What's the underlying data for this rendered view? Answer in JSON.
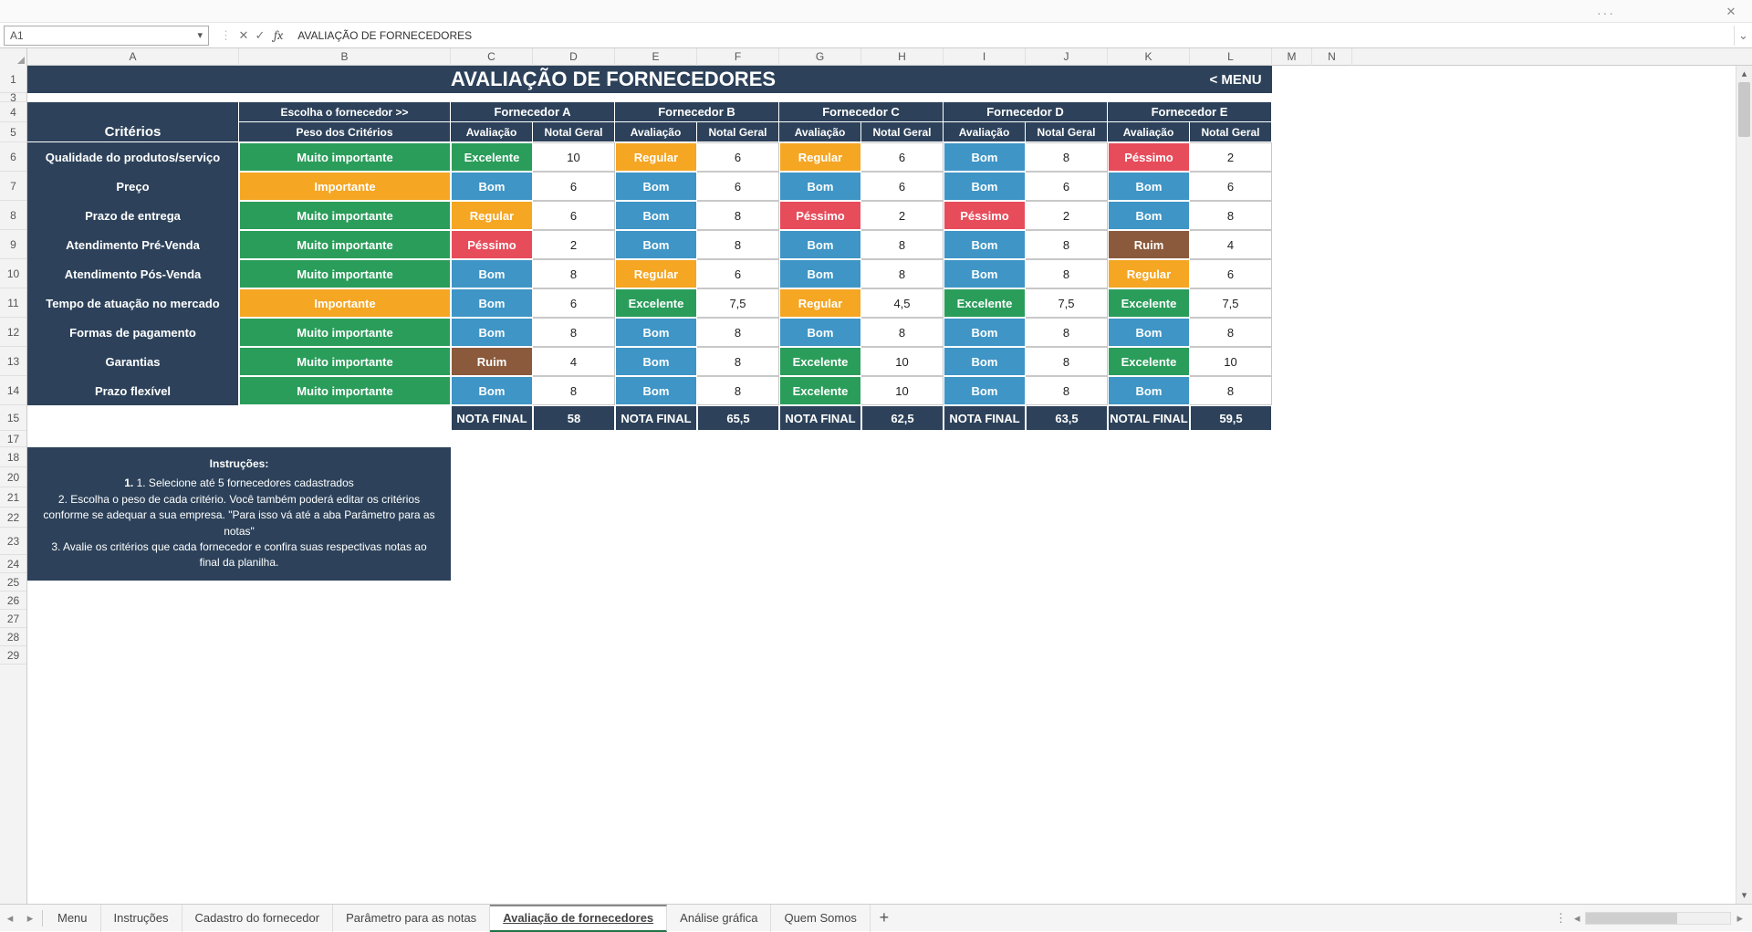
{
  "window": {
    "dots": "···",
    "close": "✕"
  },
  "formula_bar": {
    "cell_ref": "A1",
    "cancel": "✕",
    "confirm": "✓",
    "fx": "fx",
    "value": "AVALIAÇÃO DE FORNECEDORES"
  },
  "columns": [
    "A",
    "B",
    "C",
    "D",
    "E",
    "F",
    "G",
    "H",
    "I",
    "J",
    "K",
    "L",
    "M",
    "N"
  ],
  "rows_displayed": [
    "1",
    "3",
    "4",
    "5",
    "6",
    "7",
    "8",
    "9",
    "10",
    "11",
    "12",
    "13",
    "14",
    "15",
    "17",
    "18",
    "20",
    "21",
    "22",
    "23",
    "24",
    "25",
    "26",
    "27",
    "28",
    "29"
  ],
  "banner": {
    "title": "AVALIAÇÃO DE FORNECEDORES",
    "menu": "< MENU"
  },
  "headers": {
    "criterios": "Critérios",
    "escolha": "Escolha o fornecedor >>",
    "peso": "Peso dos Critérios",
    "suppliers": [
      "Fornecedor A",
      "Fornecedor B",
      "Fornecedor C",
      "Fornecedor D",
      "Fornecedor E"
    ],
    "avaliacao": "Avaliação",
    "nota": "Notal Geral"
  },
  "weights": {
    "mi": "Muito importante",
    "im": "Importante"
  },
  "ratings": {
    "exc": "Excelente",
    "bom": "Bom",
    "reg": "Regular",
    "ruim": "Ruim",
    "pes": "Péssimo"
  },
  "criteria": [
    {
      "name": "Qualidade do produtos/serviço",
      "weight": "mi",
      "vals": [
        [
          "exc",
          "10"
        ],
        [
          "reg",
          "6"
        ],
        [
          "reg",
          "6"
        ],
        [
          "bom",
          "8"
        ],
        [
          "pes",
          "2"
        ]
      ]
    },
    {
      "name": "Preço",
      "weight": "im",
      "vals": [
        [
          "bom",
          "6"
        ],
        [
          "bom",
          "6"
        ],
        [
          "bom",
          "6"
        ],
        [
          "bom",
          "6"
        ],
        [
          "bom",
          "6"
        ]
      ]
    },
    {
      "name": "Prazo de entrega",
      "weight": "mi",
      "vals": [
        [
          "reg",
          "6"
        ],
        [
          "bom",
          "8"
        ],
        [
          "pes",
          "2"
        ],
        [
          "pes",
          "2"
        ],
        [
          "bom",
          "8"
        ]
      ]
    },
    {
      "name": "Atendimento Pré-Venda",
      "weight": "mi",
      "vals": [
        [
          "pes",
          "2"
        ],
        [
          "bom",
          "8"
        ],
        [
          "bom",
          "8"
        ],
        [
          "bom",
          "8"
        ],
        [
          "ruim",
          "4"
        ]
      ]
    },
    {
      "name": "Atendimento Pós-Venda",
      "weight": "mi",
      "vals": [
        [
          "bom",
          "8"
        ],
        [
          "reg",
          "6"
        ],
        [
          "bom",
          "8"
        ],
        [
          "bom",
          "8"
        ],
        [
          "reg",
          "6"
        ]
      ]
    },
    {
      "name": "Tempo de atuação no mercado",
      "weight": "im",
      "vals": [
        [
          "bom",
          "6"
        ],
        [
          "exc",
          "7,5"
        ],
        [
          "reg",
          "4,5"
        ],
        [
          "exc",
          "7,5"
        ],
        [
          "exc",
          "7,5"
        ]
      ]
    },
    {
      "name": "Formas de pagamento",
      "weight": "mi",
      "vals": [
        [
          "bom",
          "8"
        ],
        [
          "bom",
          "8"
        ],
        [
          "bom",
          "8"
        ],
        [
          "bom",
          "8"
        ],
        [
          "bom",
          "8"
        ]
      ]
    },
    {
      "name": "Garantias",
      "weight": "mi",
      "vals": [
        [
          "ruim",
          "4"
        ],
        [
          "bom",
          "8"
        ],
        [
          "exc",
          "10"
        ],
        [
          "bom",
          "8"
        ],
        [
          "exc",
          "10"
        ]
      ]
    },
    {
      "name": "Prazo flexível",
      "weight": "mi",
      "vals": [
        [
          "bom",
          "8"
        ],
        [
          "bom",
          "8"
        ],
        [
          "exc",
          "10"
        ],
        [
          "bom",
          "8"
        ],
        [
          "bom",
          "8"
        ]
      ]
    }
  ],
  "totals": {
    "label": "NOTA FINAL",
    "label_alt": "NOTAL FINAL",
    "values": [
      "58",
      "65,5",
      "62,5",
      "63,5",
      "59,5"
    ]
  },
  "instructions": {
    "title": "Instruções:",
    "l1": "1. Selecione até 5 fornecedores cadastrados",
    "l2": "2. Escolha o peso de cada critério. Você também poderá editar os critérios conforme se adequar a sua empresa. \"Para isso vá até a aba Parâmetro para as notas\"",
    "l3": "3. Avalie os critérios que cada fornecedor e confira suas respectivas notas ao final da planilha."
  },
  "tabs": {
    "items": [
      "Menu",
      "Instruções",
      "Cadastro do fornecedor",
      "Parâmetro para as notas",
      "Avaliação de fornecedores",
      "Análise gráfica",
      "Quem Somos"
    ],
    "active_index": 4,
    "add": "+"
  }
}
